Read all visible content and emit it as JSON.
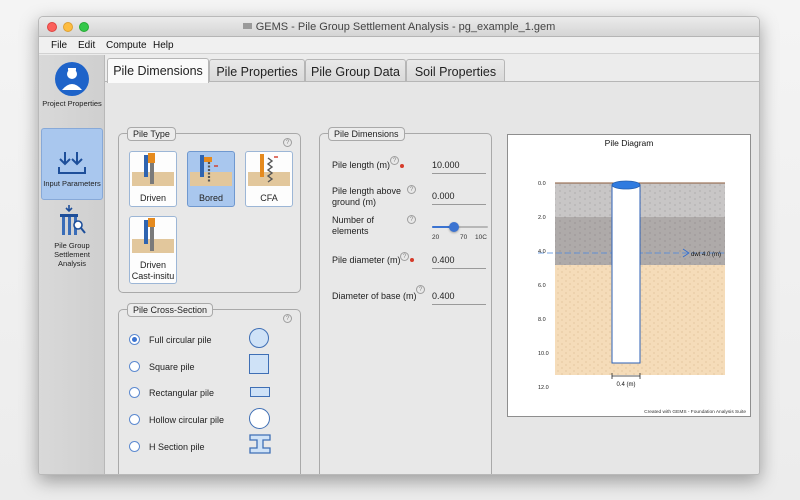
{
  "window": {
    "title": "GEMS - Pile Group Settlement Analysis - pg_example_1.gem"
  },
  "menu": [
    "File",
    "Edit",
    "Compute",
    "Help"
  ],
  "sidebar": [
    {
      "label": "Project Properties",
      "icon": "person-badge-icon"
    },
    {
      "label": "Input Parameters",
      "icon": "download-arrows-icon"
    },
    {
      "label": "Pile Group Settlement Analysis",
      "icon": "pile-group-icon"
    }
  ],
  "tabs": [
    "Pile Dimensions",
    "Pile Properties",
    "Pile Group Data",
    "Soil Properties"
  ],
  "pile_type": {
    "title": "Pile Type",
    "options": [
      "Driven",
      "Bored",
      "CFA",
      "Driven Cast-insitu"
    ],
    "selected": "Bored"
  },
  "cross_section": {
    "title": "Pile Cross-Section",
    "options": [
      "Full circular pile",
      "Square pile",
      "Rectangular pile",
      "Hollow circular pile",
      "H Section pile"
    ],
    "selected": "Full circular pile"
  },
  "dims": {
    "title": "Pile Dimensions",
    "pile_length_label": "Pile length (m)",
    "pile_length": "10.000",
    "above_ground_label": "Pile length above ground (m)",
    "above_ground": "0.000",
    "elements_label": "Number of elements",
    "elements_ticks": [
      "20",
      "70",
      "10C"
    ],
    "elements_level": 0.37,
    "diameter_label": "Pile diameter (m)",
    "diameter": "0.400",
    "base_label": "Diameter of base (m)",
    "base": "0.400"
  },
  "diagram": {
    "title": "Pile Diagram",
    "depth_labels": [
      "0.0",
      "2.0",
      "4.0",
      "6.0",
      "8.0",
      "10.0",
      "12.0"
    ],
    "water_label": "dwt 4.0 (m)",
    "diameter_label": "0.4 (m)",
    "credit": "Created with GEMS - Foundation Analysis Suite"
  },
  "colors": {
    "accent": "#3b73d1",
    "selected_card": "#a9c7ee",
    "required": "#d63b2a"
  }
}
